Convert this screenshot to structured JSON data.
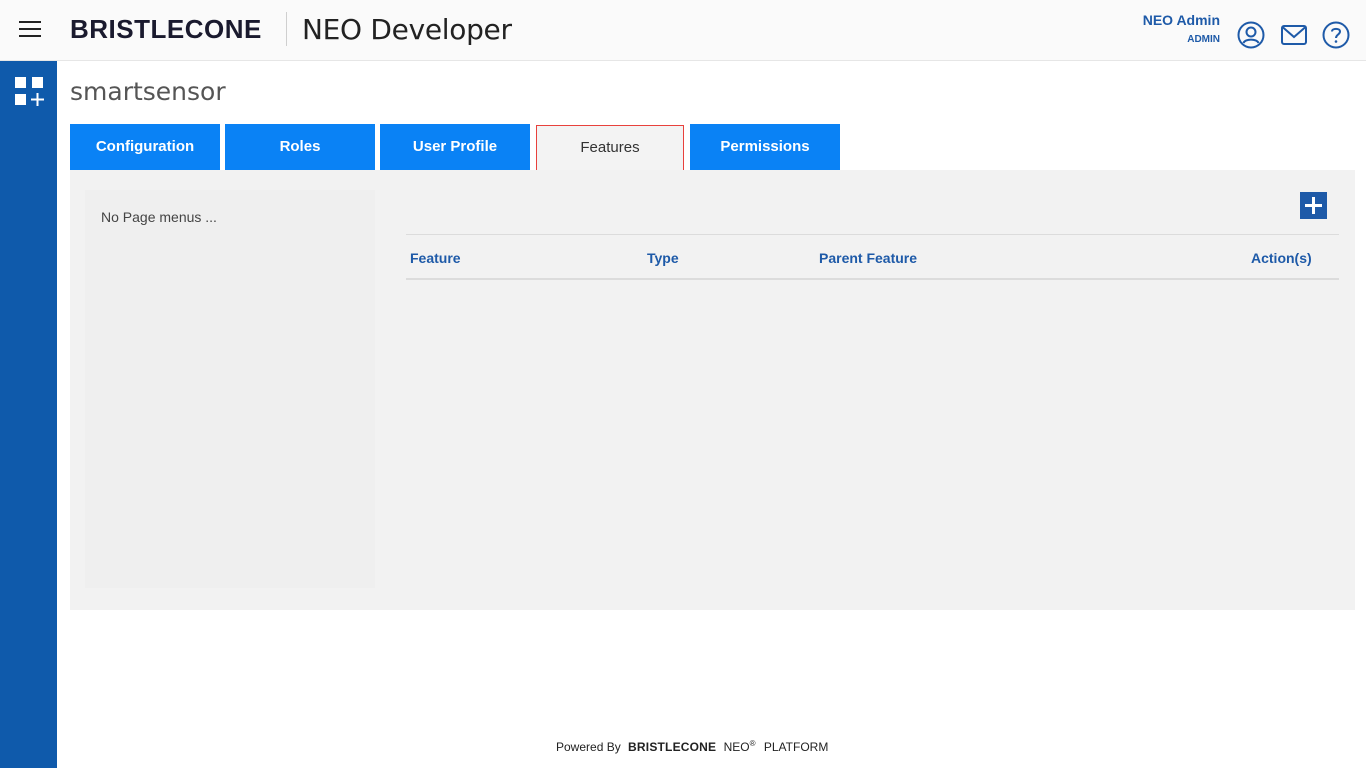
{
  "header": {
    "brand": "BRISTLECONE",
    "app_title": "NEO Developer",
    "user_name": "NEO Admin",
    "user_role": "ADMIN",
    "icons": [
      "menu-icon",
      "user-icon",
      "mail-icon",
      "help-icon"
    ]
  },
  "rail": {
    "icons": [
      "apps-add-icon"
    ]
  },
  "page": {
    "title": "smartsensor"
  },
  "tabs": [
    {
      "label": "Configuration",
      "active": false
    },
    {
      "label": "Roles",
      "active": false
    },
    {
      "label": "User Profile",
      "active": false
    },
    {
      "label": "Features",
      "active": true
    },
    {
      "label": "Permissions",
      "active": false
    }
  ],
  "leftnav": {
    "empty_text": "No Page menus ..."
  },
  "table": {
    "columns": [
      "Feature",
      "Type",
      "Parent Feature",
      "Action(s)"
    ],
    "rows": []
  },
  "footer": {
    "powered_by": "Powered By",
    "brand": "BRISTLECONE",
    "product": "NEO",
    "registered": "®",
    "platform": "PLATFORM"
  },
  "colors": {
    "rail": "#0f5aab",
    "tab": "#0a82f5",
    "active_tab_border": "#e8413c",
    "heading_blue": "#1e5aa8"
  }
}
